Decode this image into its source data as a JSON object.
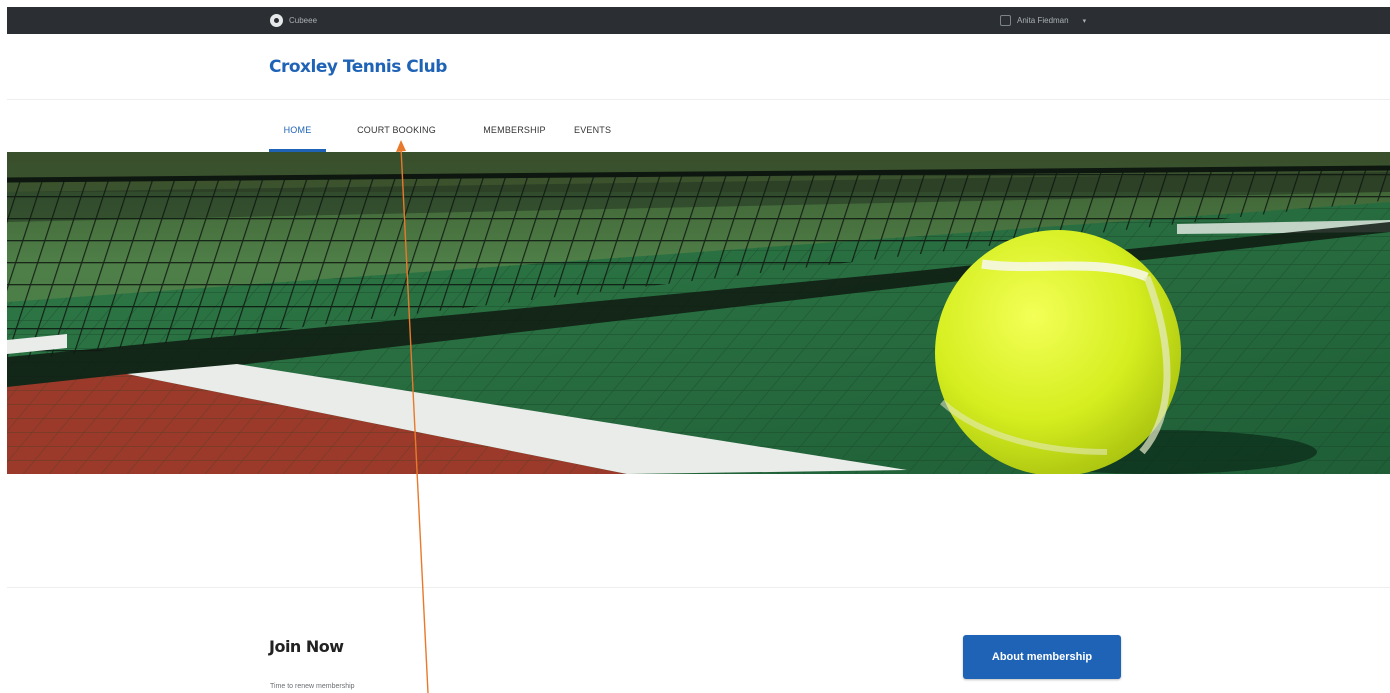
{
  "topbar": {
    "brand": "Cubeee",
    "user": "Anita Fiedman"
  },
  "site": {
    "title": "Croxley Tennis Club"
  },
  "nav": {
    "items": [
      {
        "label": "HOME",
        "active": true
      },
      {
        "label": "COURT BOOKING",
        "active": false
      },
      {
        "label": "MEMBERSHIP",
        "active": false
      },
      {
        "label": "EVENTS",
        "active": false
      }
    ]
  },
  "hero": {
    "alt": "Tennis ball next to net on green court"
  },
  "join": {
    "title": "Join Now",
    "text": "Time to renew membership"
  },
  "about_button": {
    "label": "About membership"
  },
  "colors": {
    "accent": "#1f63b6",
    "topbar": "#2b2f33",
    "annotation": "#e8792b"
  }
}
